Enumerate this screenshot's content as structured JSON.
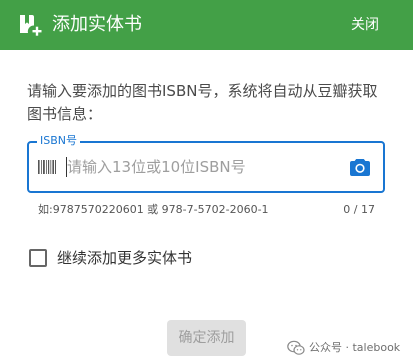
{
  "header": {
    "title": "添加实体书",
    "close_label": "关闭",
    "background_color": "#43a047",
    "icon": "add-book-icon"
  },
  "intro_text": "请输入要添加的图书ISBN号，系统将自动从豆瓣获取图书信息：",
  "isbn_field": {
    "label": "ISBN号",
    "value": "",
    "placeholder": "请输入13位或10位ISBN号",
    "hint": "如:9787570220601 或 978-7-5702-2060-1",
    "counter": "0 / 17",
    "accent_color": "#1976d2",
    "leading_icon": "barcode-icon",
    "trailing_icon": "camera-icon"
  },
  "continue_checkbox": {
    "label": "继续添加更多实体书",
    "checked": false
  },
  "confirm_button": {
    "label": "确定添加",
    "disabled": true
  },
  "watermark": {
    "text": "公众号 · talebook",
    "icon": "wechat-icon"
  }
}
